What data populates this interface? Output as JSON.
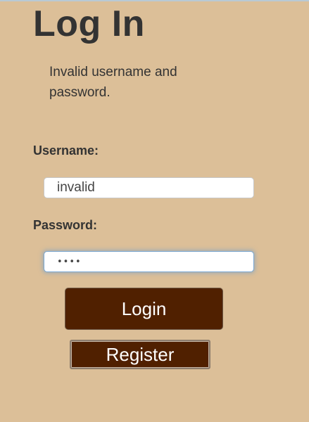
{
  "page": {
    "title": "Log In",
    "error_message": "Invalid username and password."
  },
  "form": {
    "username_label": "Username:",
    "username_value": "invalid",
    "password_label": "Password:",
    "password_value": "pass",
    "login_label": "Login",
    "register_label": "Register"
  },
  "colors": {
    "background": "#dcbf98",
    "button": "#502000",
    "text": "#333333"
  }
}
